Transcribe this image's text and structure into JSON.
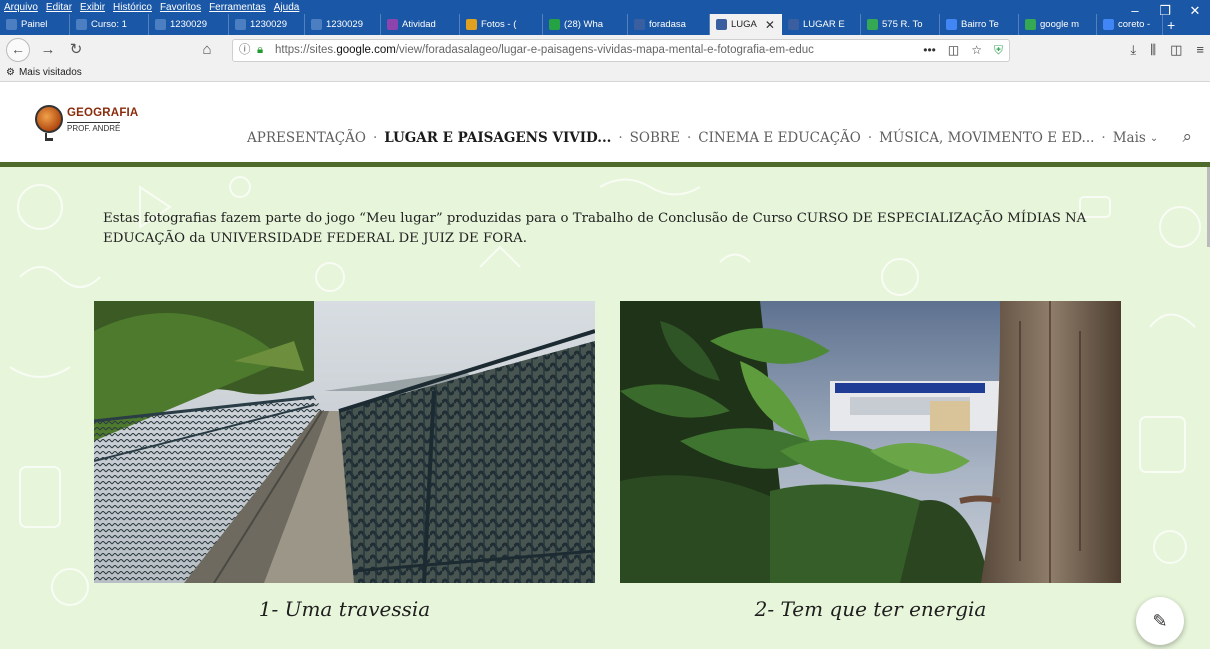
{
  "browser": {
    "menu": [
      "Arquivo",
      "Editar",
      "Exibir",
      "Histórico",
      "Favoritos",
      "Ferramentas",
      "Ajuda"
    ],
    "window_controls": [
      "–",
      "❐",
      "✕"
    ],
    "tabs": [
      {
        "label": "Painel",
        "icon": "ufjf-icon",
        "color": "#4b7fc2"
      },
      {
        "label": "Curso: 1",
        "icon": "ufjf-icon",
        "color": "#4b7fc2"
      },
      {
        "label": "1230029",
        "icon": "ufjf-icon",
        "color": "#4b7fc2"
      },
      {
        "label": "1230029",
        "icon": "ufjf-icon",
        "color": "#4b7fc2"
      },
      {
        "label": "1230029",
        "icon": "ufjf-icon",
        "color": "#4b7fc2"
      },
      {
        "label": "Atividad",
        "icon": "classroom-icon",
        "color": "#8e44ad"
      },
      {
        "label": "Fotos - (",
        "icon": "photos-icon",
        "color": "#e0a020"
      },
      {
        "label": "(28) Wha",
        "icon": "whatsapp-icon",
        "color": "#25a244"
      },
      {
        "label": "foradasa",
        "icon": "sites-icon",
        "color": "#3a5fa0"
      },
      {
        "label": "LUGA",
        "icon": "sites-icon",
        "color": "#3a5fa0",
        "active": true
      },
      {
        "label": "LUGAR E",
        "icon": "sites-icon",
        "color": "#3a5fa0"
      },
      {
        "label": "575 R. To",
        "icon": "maps-icon",
        "color": "#34a853"
      },
      {
        "label": "Bairro Te",
        "icon": "google-icon",
        "color": "#4285f4"
      },
      {
        "label": "google m",
        "icon": "maps-icon",
        "color": "#34a853"
      },
      {
        "label": "coreto -",
        "icon": "google-icon",
        "color": "#4285f4"
      }
    ],
    "new_tab": "+",
    "url_prefix": "https://sites.",
    "url_host": "google.com",
    "url_path": "/view/foradasalageo/lugar-e-paisagens-vividas-mapa-mental-e-fotografia-em-educ",
    "bookmark": "Mais visitados"
  },
  "site": {
    "logo_title": "GEOGRAFIA",
    "logo_subtitle": "PROF. ANDRÉ",
    "nav": [
      {
        "label": "APRESENTAÇÃO"
      },
      {
        "label": "LUGAR E PAISAGENS VIVID...",
        "active": true
      },
      {
        "label": "SOBRE"
      },
      {
        "label": "CINEMA E EDUCAÇÃO"
      },
      {
        "label": "MÚSICA, MOVIMENTO E ED..."
      },
      {
        "label": "Mais"
      }
    ],
    "intro": "Estas fotografias fazem parte do jogo “Meu lugar” produzidas para o Trabalho de Conclusão de Curso  CURSO DE ESPECIALIZAÇÃO MÍDIAS NA EDUCAÇÃO da UNIVERSIDADE FEDERAL DE JUIZ DE FORA.",
    "photos": [
      {
        "caption": "1- Uma travessia"
      },
      {
        "caption": "2- Tem que ter energia"
      }
    ]
  },
  "colors": {
    "titlebar": "#1a57a6",
    "header_border": "#4f6b2b",
    "content_bg": "#e7f5da"
  }
}
